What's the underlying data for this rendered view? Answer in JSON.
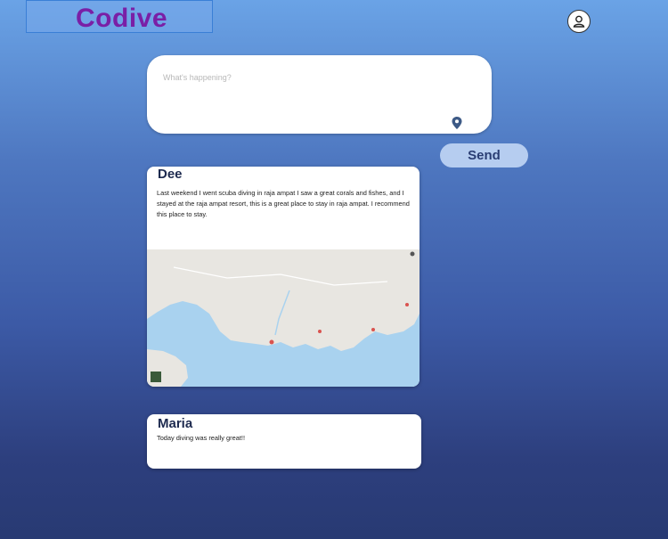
{
  "header": {
    "logo": "Codive",
    "profile_icon": "user-icon"
  },
  "composer": {
    "placeholder": "What's happening?",
    "location_icon": "location-pin-icon",
    "send_label": "Send"
  },
  "posts": [
    {
      "author": "Dee",
      "text": "Last weekend I went scuba diving in raja ampat I saw a great corals and fishes, and I stayed at the raja ampat resort, this is a great place to stay in raja ampat. I recommend this place to stay.",
      "has_map": true
    },
    {
      "author": "Maria",
      "text": "Today diving was really great!!"
    }
  ],
  "colors": {
    "logo": "#7a1fa6",
    "send_button": "#b6cdf0",
    "map_land": "#e8e6e1",
    "map_water": "#a9d2ef"
  }
}
